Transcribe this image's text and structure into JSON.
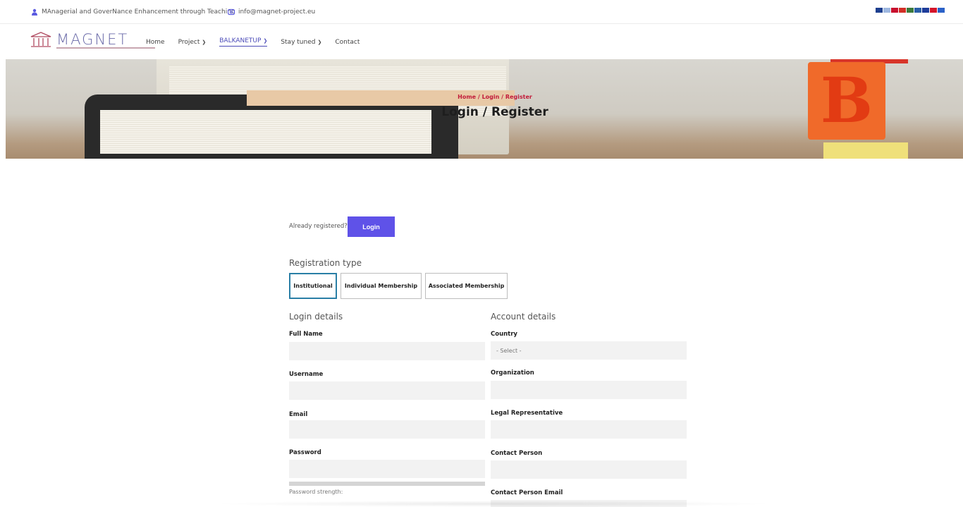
{
  "topbar": {
    "tagline": "MAnagerial and GoverNance Enhancement through Teaching",
    "email": "info@magnet-project.eu",
    "user_icon": "user-icon",
    "mail_icon": "mail-icon",
    "flags": [
      "#1d3f8f",
      "#9fb8e0",
      "#c8102e",
      "#d22f27",
      "#3c7a3c",
      "#2a5fa8",
      "#1f3d9a",
      "#d4152a",
      "#2b62c8"
    ]
  },
  "nav": {
    "logo_text": "MAGNET",
    "items": [
      {
        "label": "Home",
        "has_dropdown": false
      },
      {
        "label": "Project",
        "has_dropdown": true
      },
      {
        "label": "BALKANETUP",
        "has_dropdown": true,
        "active": true
      },
      {
        "label": "Stay tuned",
        "has_dropdown": true
      },
      {
        "label": "Contact",
        "has_dropdown": false
      }
    ],
    "accent": "#4a4ab8"
  },
  "hero": {
    "breadcrumb": "Home  /  Login / Register",
    "title": "Login / Register",
    "block_letter": "B"
  },
  "form": {
    "already_registered": "Already registered?",
    "login_button": "Login",
    "registration_type_label": "Registration type",
    "registration_types": [
      {
        "label": "Institutional",
        "selected": true
      },
      {
        "label": "Individual Membership",
        "selected": false
      },
      {
        "label": "Associated Membership",
        "selected": false
      }
    ],
    "login_details_heading": "Login details",
    "account_details_heading": "Account details",
    "login_fields": [
      {
        "label": "Full Name",
        "value": ""
      },
      {
        "label": "Username",
        "value": ""
      },
      {
        "label": "Email",
        "value": ""
      },
      {
        "label": "Password",
        "value": ""
      }
    ],
    "account_fields": [
      {
        "label": "Country",
        "value": "- Select -"
      },
      {
        "label": "Organization",
        "value": ""
      },
      {
        "label": "Legal Representative",
        "value": ""
      },
      {
        "label": "Contact Person",
        "value": ""
      },
      {
        "label": "Contact Person Email",
        "value": ""
      }
    ],
    "password_strength_label": "Password strength:",
    "button_color": "#5f52e8",
    "selected_tab_border": "#2a7fa6"
  }
}
